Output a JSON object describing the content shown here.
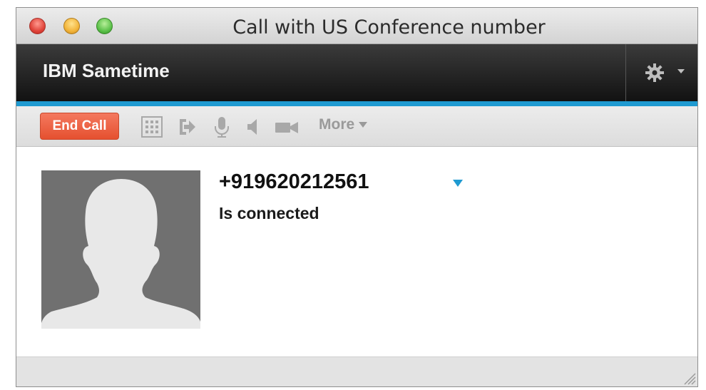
{
  "window": {
    "title": "Call with US Conference number"
  },
  "app": {
    "name": "IBM Sametime",
    "accent_color": "#1f9ad1",
    "settings_icon": "gear-icon"
  },
  "toolbar": {
    "end_call_label": "End Call",
    "end_call_color": "#e5502f",
    "icons": [
      "dialpad-icon",
      "transfer-icon",
      "microphone-icon",
      "speaker-icon",
      "video-icon"
    ],
    "more_label": "More"
  },
  "call": {
    "number": "+919620212561",
    "status": "Is connected"
  }
}
